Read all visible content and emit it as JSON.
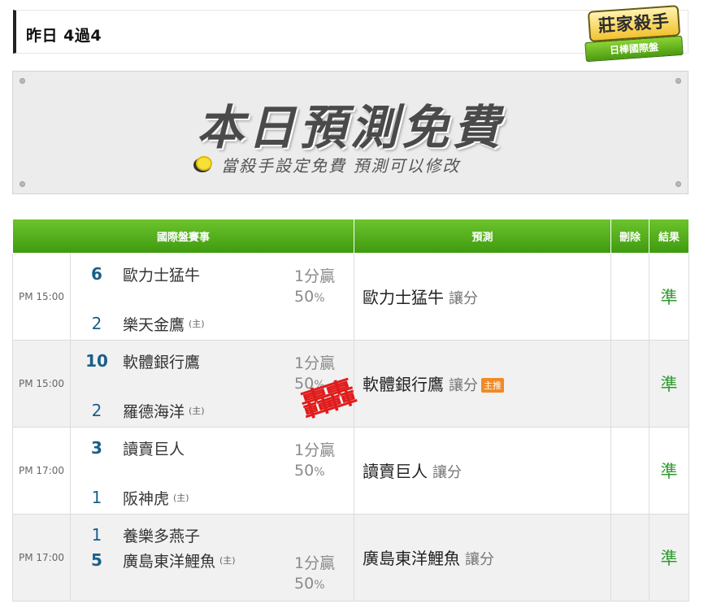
{
  "header": {
    "title": "昨日 4過4"
  },
  "logo": {
    "main": "莊家殺手",
    "sub": "日棒國際盤"
  },
  "banner": {
    "headline": "本日預測免費",
    "subline": "當殺手設定免費  預測可以修改"
  },
  "table": {
    "headers": {
      "match": "國際盤賽事",
      "prediction": "預測",
      "delete": "刪除",
      "result": "結果"
    },
    "home_mark": "(主)",
    "rows": [
      {
        "time": "PM 15:00",
        "team1_num": "6",
        "team1": "歐力士猛牛",
        "team2_num": "2",
        "team2": "樂天金鷹",
        "home": "(主)",
        "line": "1分贏",
        "pct": "50",
        "pct_unit": "%",
        "pick": "歐力士猛牛",
        "pick_type": "讓分",
        "tag": "",
        "result": "準"
      },
      {
        "time": "PM 15:00",
        "team1_num": "10",
        "team1": "軟體銀行鷹",
        "team2_num": "2",
        "team2": "羅德海洋",
        "home": "(主)",
        "line": "1分贏",
        "pct": "50",
        "pct_unit": "%",
        "pick": "軟體銀行鷹",
        "pick_type": "讓分",
        "tag": "主推",
        "result": "準"
      },
      {
        "time": "PM 17:00",
        "team1_num": "3",
        "team1": "讀賣巨人",
        "team2_num": "1",
        "team2": "阪神虎",
        "home": "(主)",
        "line": "1分贏",
        "pct": "50",
        "pct_unit": "%",
        "pick": "讀賣巨人",
        "pick_type": "讓分",
        "tag": "",
        "result": "準"
      },
      {
        "time": "PM 17:00",
        "team1_num": "1",
        "team1": "養樂多燕子",
        "team2_num": "5",
        "team2": "廣島東洋鯉魚",
        "home": "(主)",
        "line": "1分贏",
        "pct": "50",
        "pct_unit": "%",
        "pick": "廣島東洋鯉魚",
        "pick_type": "讓分",
        "tag": "",
        "result": "準"
      }
    ]
  },
  "stamp": {
    "text": "轟轟"
  },
  "colors": {
    "header_green": "#4fab1a",
    "result_green": "#2f9a2f",
    "team_number_blue": "#1a5f8a",
    "stamp_red": "#e01c1c",
    "tag_orange": "#f08a24"
  },
  "icons": {
    "banner_icon": "lightbulb-icon"
  }
}
